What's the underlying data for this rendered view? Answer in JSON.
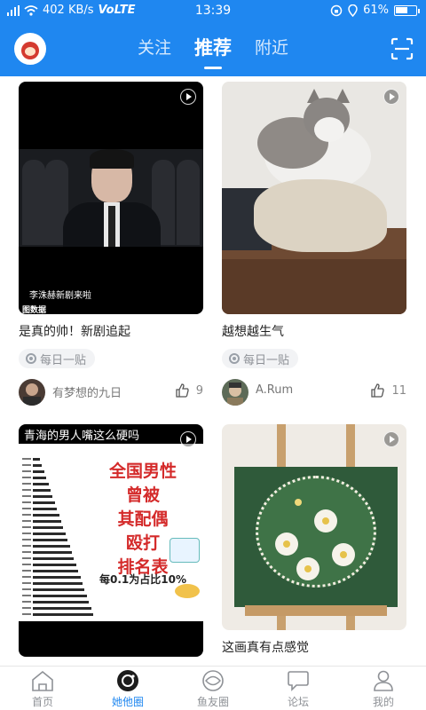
{
  "status_bar": {
    "speed": "402 KB/s",
    "network": "VoLTE",
    "time": "13:39",
    "battery": "61%",
    "battery_level": 0.61
  },
  "header": {
    "tabs": [
      {
        "label": "关注",
        "active": false
      },
      {
        "label": "推荐",
        "active": true
      },
      {
        "label": "附近",
        "active": false
      }
    ],
    "scan_icon": "scan-icon",
    "accent_color": "#1f87f0"
  },
  "feed": {
    "cards": [
      {
        "title": "是真的帅！新剧追起",
        "tag": "每日一贴",
        "user": "有梦想的九日",
        "likes": "9",
        "media_caption": "李洙赫新剧来啦",
        "media_logo": "图数据"
      },
      {
        "title": "越想越生气",
        "tag": "每日一贴",
        "user": "A.Rum",
        "likes": "11"
      },
      {
        "media_heading": "青海的男人嘴这么硬吗",
        "media_big_lines": [
          "全国男性",
          "曾被",
          "其配偶",
          "殴打",
          "排名表"
        ],
        "media_small": "每0.1为占比10%"
      },
      {
        "title": "这画真有点感觉"
      }
    ]
  },
  "bottom_nav": {
    "items": [
      {
        "label": "首页",
        "icon": "home-icon",
        "active": false
      },
      {
        "label": "她他圈",
        "icon": "circle-camera-icon",
        "active": true
      },
      {
        "label": "鱼友圈",
        "icon": "fish-circle-icon",
        "active": false
      },
      {
        "label": "论坛",
        "icon": "chat-bubble-icon",
        "active": false
      },
      {
        "label": "我的",
        "icon": "profile-icon",
        "active": false
      }
    ]
  }
}
